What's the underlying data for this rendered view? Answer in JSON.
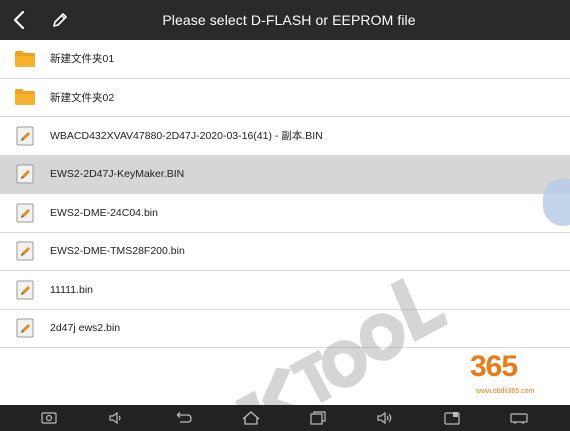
{
  "header": {
    "title": "Please select D-FLASH or EEPROM file",
    "back_icon": "chevron-left-icon",
    "edit_icon": "pencil-icon"
  },
  "files": [
    {
      "name": "新建文件夹01",
      "type": "folder",
      "selected": false
    },
    {
      "name": "新建文件夹02",
      "type": "folder",
      "selected": false
    },
    {
      "name": "WBACD432XVAV47880-2D47J-2020-03-16(41) - 副本.BIN",
      "type": "file",
      "selected": false
    },
    {
      "name": "EWS2-2D47J-KeyMaker.BIN",
      "type": "file",
      "selected": true
    },
    {
      "name": "EWS2-DME-24C04.bin",
      "type": "file",
      "selected": false
    },
    {
      "name": "EWS2-DME-TMS28F200.bin",
      "type": "file",
      "selected": false
    },
    {
      "name": "11111.bin",
      "type": "file",
      "selected": false
    },
    {
      "name": "2d47j ews2.bin",
      "type": "file",
      "selected": false
    }
  ],
  "watermarks": {
    "tool_logo": "KTOOL",
    "brand_digits": "365",
    "brand_url": "www.obdii365.com"
  },
  "navbar": [
    {
      "name": "screenshot-icon"
    },
    {
      "name": "volume-down-icon"
    },
    {
      "name": "back-arrow-icon"
    },
    {
      "name": "home-icon"
    },
    {
      "name": "recent-apps-icon"
    },
    {
      "name": "volume-up-icon"
    },
    {
      "name": "app-icon"
    },
    {
      "name": "device-icon"
    }
  ],
  "colors": {
    "topbar": "#2a2a2a",
    "selected_row": "#d6d6d6",
    "folder": "#f0a21a",
    "brand_orange": "#f07a12",
    "navbar": "#222222"
  }
}
